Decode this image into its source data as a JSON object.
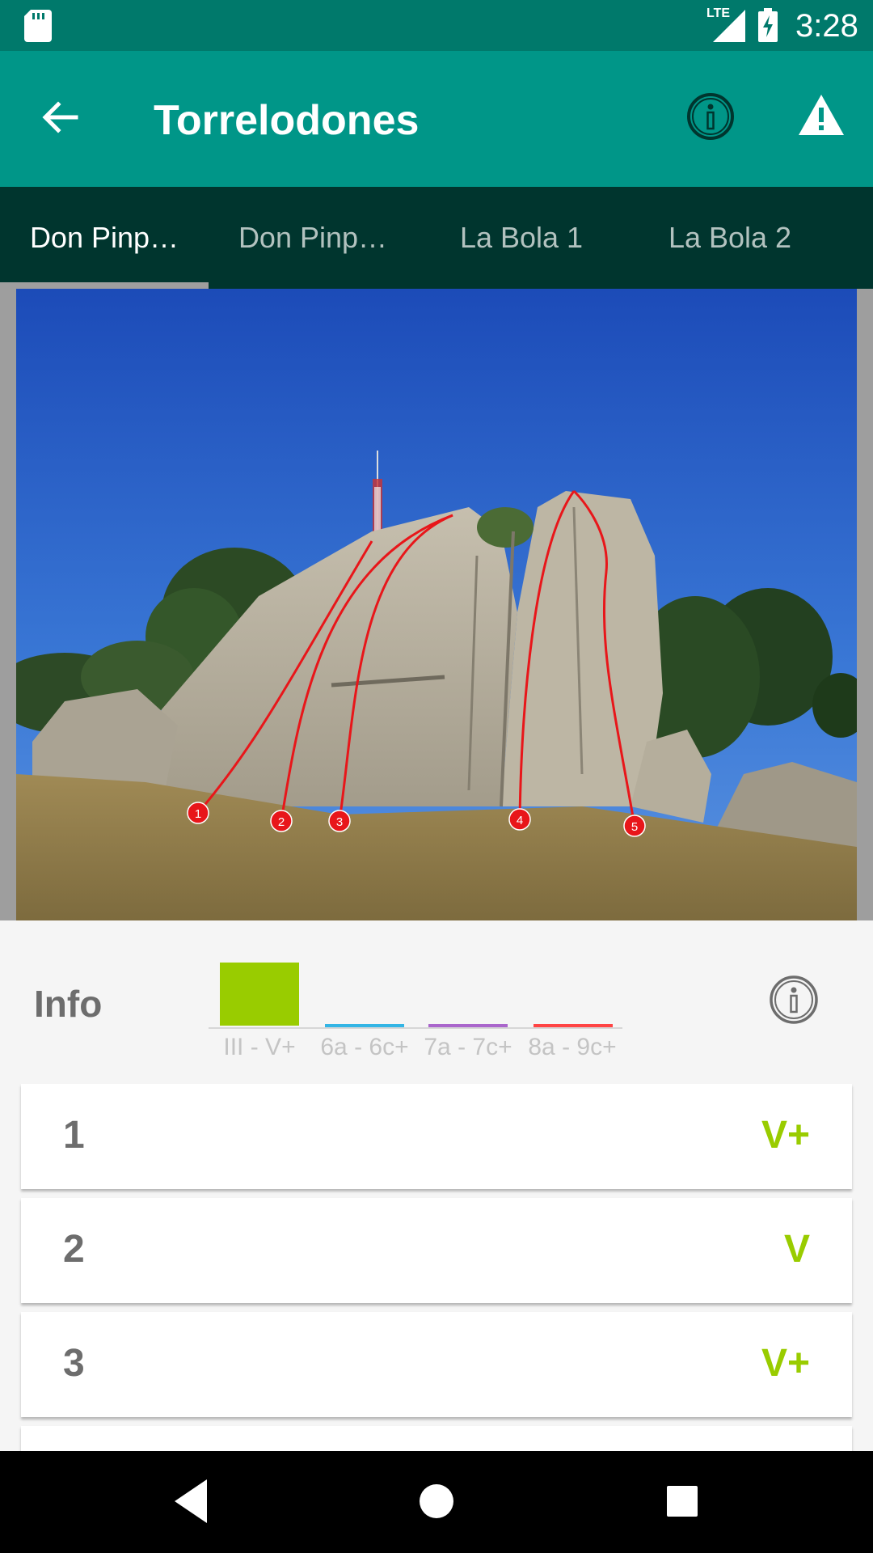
{
  "status_bar": {
    "time": "3:28",
    "network": "LTE"
  },
  "app_bar": {
    "title": "Torrelodones"
  },
  "tabs": [
    {
      "label": "Don Pinp…"
    },
    {
      "label": "Don Pinp…"
    },
    {
      "label": "La Bola 1"
    },
    {
      "label": "La Bola 2"
    }
  ],
  "topo": {
    "markers": [
      "1",
      "2",
      "3",
      "4",
      "5"
    ],
    "line_color": "#e8161a"
  },
  "info": {
    "label": "Info",
    "legend": [
      {
        "label": "III - V+",
        "color": "#99cc00",
        "selected": true
      },
      {
        "label": "6a - 6c+",
        "color": "#33b5e5",
        "selected": false
      },
      {
        "label": "7a - 7c+",
        "color": "#aa66cc",
        "selected": false
      },
      {
        "label": "8a - 9c+",
        "color": "#ff4444",
        "selected": false
      }
    ]
  },
  "routes": [
    {
      "number": "1",
      "grade": "V+",
      "grade_color": "#99cc00"
    },
    {
      "number": "2",
      "grade": "V",
      "grade_color": "#99cc00"
    },
    {
      "number": "3",
      "grade": "V+",
      "grade_color": "#99cc00"
    }
  ],
  "colors": {
    "status_bar": "#00796b",
    "app_bar": "#009688",
    "tab_bar": "#00352e",
    "grade_green": "#99cc00"
  }
}
